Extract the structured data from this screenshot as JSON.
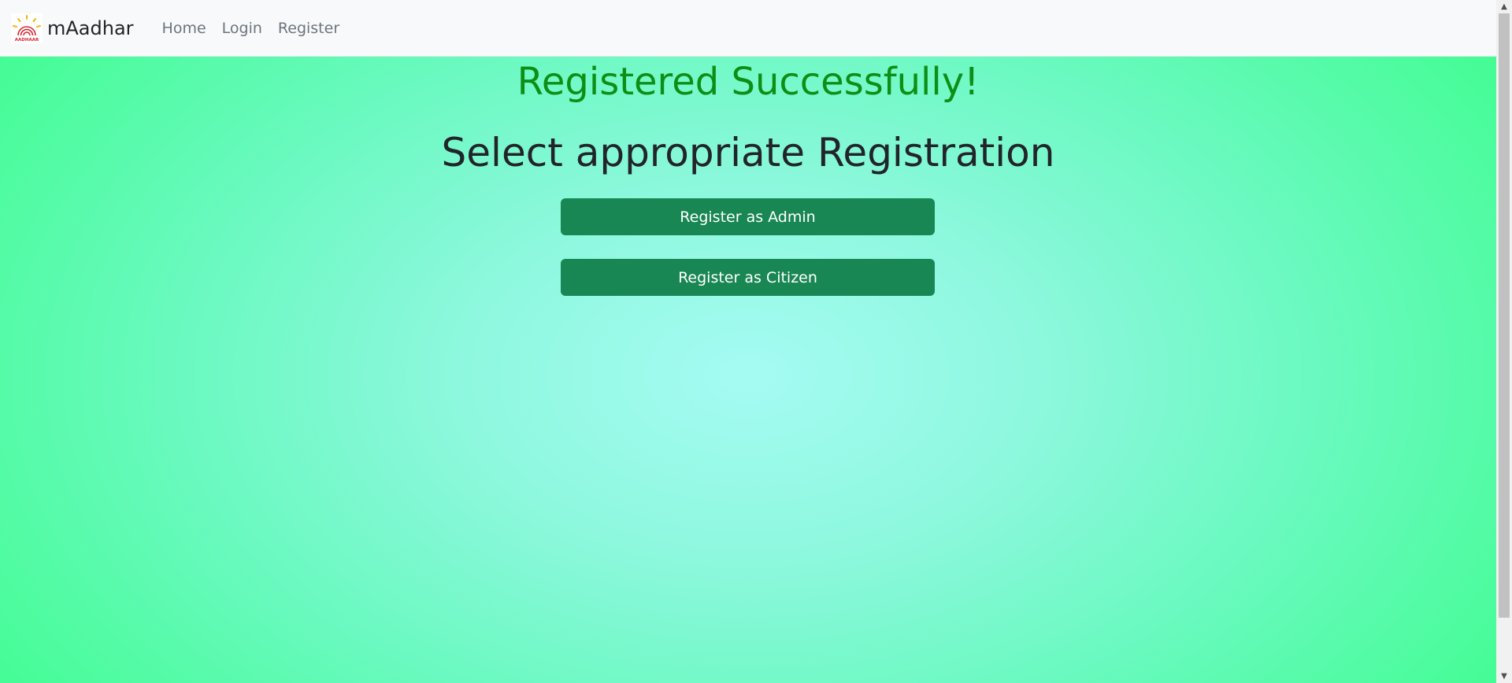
{
  "navbar": {
    "brand_name": "mAadhar",
    "logo_icon": "aadhaar-logo-icon",
    "links": [
      "Home",
      "Login",
      "Register"
    ]
  },
  "main": {
    "success_message": "Registered Successfully!",
    "heading": "Select appropriate Registration",
    "buttons": {
      "admin": "Register as Admin",
      "citizen": "Register as Citizen"
    }
  },
  "colors": {
    "success_text": "#0d8f16",
    "button_bg": "#198754",
    "gradient_center": "#a5fbf3",
    "gradient_edge": "#3ffd8e"
  }
}
